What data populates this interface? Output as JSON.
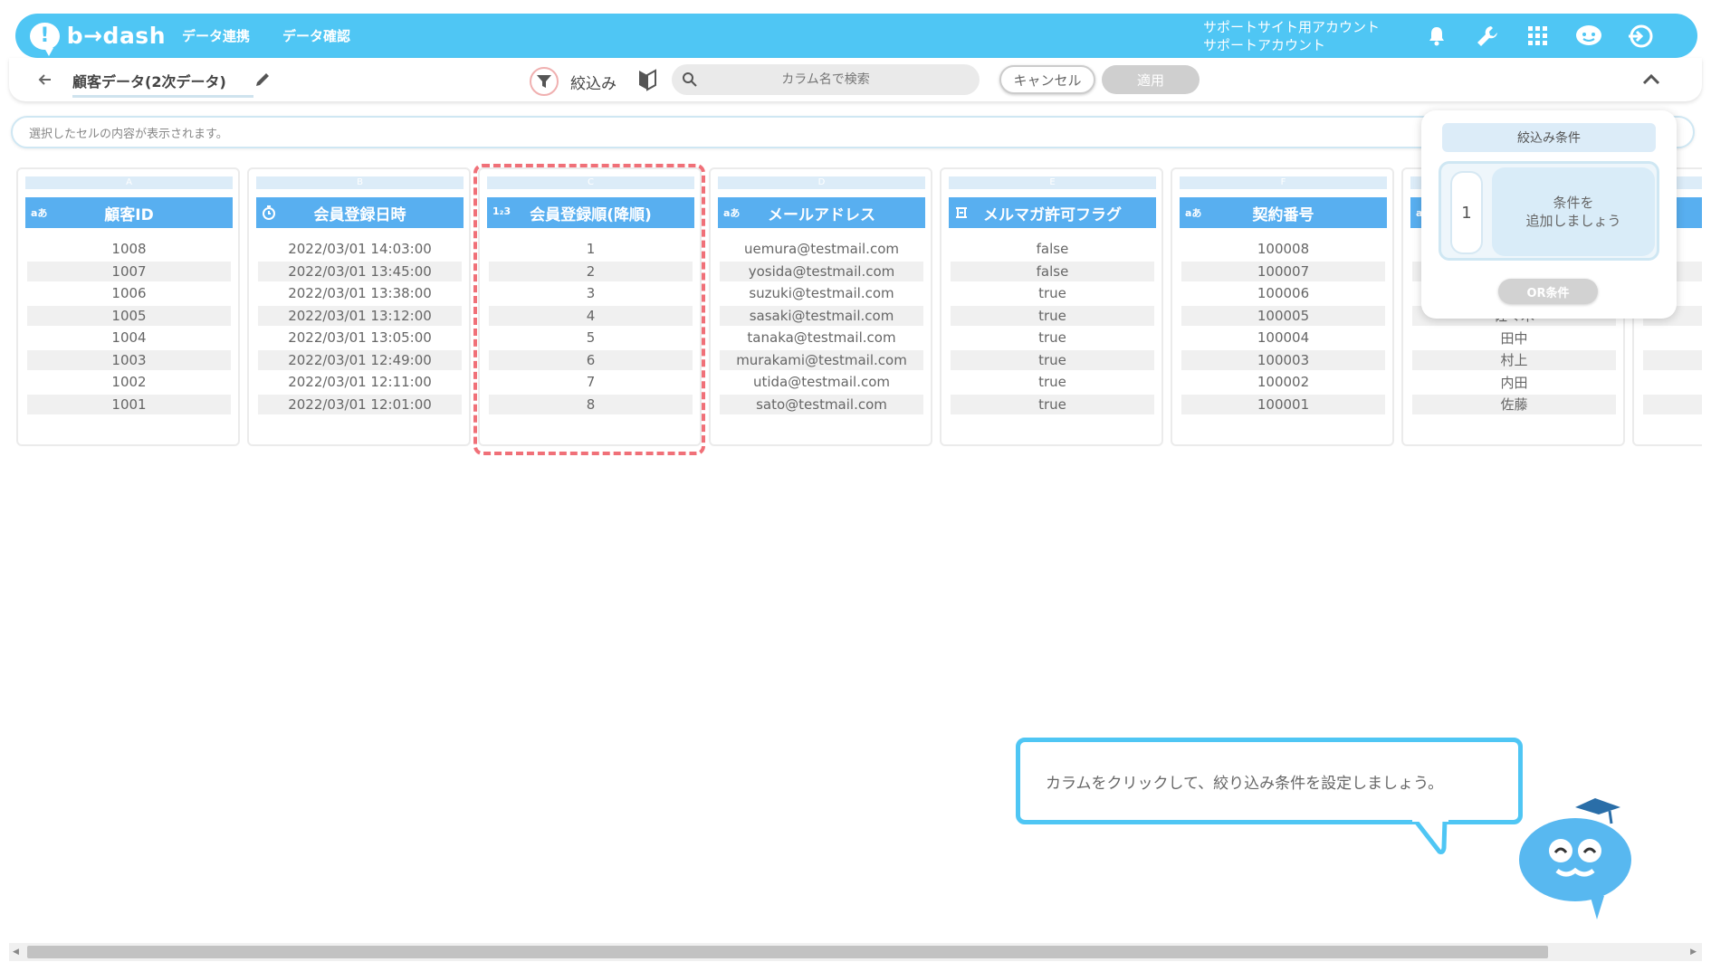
{
  "app": {
    "logo_text": "b→dash"
  },
  "nav": {
    "items": [
      "データ連携",
      "データ確認"
    ]
  },
  "account": {
    "line1": "サポートサイト用アカウント",
    "line2": "サポートアカウント"
  },
  "header_icons": [
    "bell-icon",
    "wrench-icon",
    "grid-icon",
    "mascot-face-icon",
    "logout-icon"
  ],
  "subheader": {
    "title": "顧客データ(2次データ)",
    "filter_label": "絞込み",
    "search_placeholder": "カラム名で検索",
    "cancel_label": "キャンセル",
    "apply_label": "適用"
  },
  "cellbar": {
    "placeholder": "選択したセルの内容が表示されます。"
  },
  "columns": [
    {
      "letter": "A",
      "type": "aあ",
      "header": "顧客ID",
      "cells": [
        "1008",
        "1007",
        "1006",
        "1005",
        "1004",
        "1003",
        "1002",
        "1001"
      ]
    },
    {
      "letter": "B",
      "type": "clock",
      "header": "会員登録日時",
      "cells": [
        "2022/03/01 14:03:00",
        "2022/03/01 13:45:00",
        "2022/03/01 13:38:00",
        "2022/03/01 13:12:00",
        "2022/03/01 13:05:00",
        "2022/03/01 12:49:00",
        "2022/03/01 12:11:00",
        "2022/03/01 12:01:00"
      ]
    },
    {
      "letter": "C",
      "type": "1₂3",
      "header": "会員登録順(降順)",
      "cells": [
        "1",
        "2",
        "3",
        "4",
        "5",
        "6",
        "7",
        "8"
      ],
      "selected": true
    },
    {
      "letter": "D",
      "type": "aあ",
      "header": "メールアドレス",
      "cells": [
        "uemura@testmail.com",
        "yosida@testmail.com",
        "suzuki@testmail.com",
        "sasaki@testmail.com",
        "tanaka@testmail.com",
        "murakami@testmail.com",
        "utida@testmail.com",
        "sato@testmail.com"
      ]
    },
    {
      "letter": "E",
      "type": "flag",
      "header": "メルマガ許可フラグ",
      "cells": [
        "false",
        "false",
        "true",
        "true",
        "true",
        "true",
        "true",
        "true"
      ]
    },
    {
      "letter": "F",
      "type": "aあ",
      "header": "契約番号",
      "cells": [
        "100008",
        "100007",
        "100006",
        "100005",
        "100004",
        "100003",
        "100002",
        "100001"
      ]
    },
    {
      "letter": "G",
      "type": "aあ",
      "header": "",
      "cells": [
        "",
        "",
        "",
        "佐々木",
        "田中",
        "村上",
        "内田",
        "佐藤"
      ]
    },
    {
      "letter": "H",
      "type": "",
      "header": "",
      "cells": [
        "",
        "",
        "",
        "",
        "",
        "",
        "",
        ""
      ]
    }
  ],
  "filter_panel": {
    "title": "絞込み条件",
    "condition_number": "1",
    "add_condition_line1": "条件を",
    "add_condition_line2": "追加しましょう",
    "or_label": "OR条件"
  },
  "guide": {
    "message": "カラムをクリックして、絞り込み条件を設定しましょう。"
  },
  "colors": {
    "brand": "#4fc6f4",
    "header_col": "#58aff0",
    "selection": "#f07078"
  }
}
